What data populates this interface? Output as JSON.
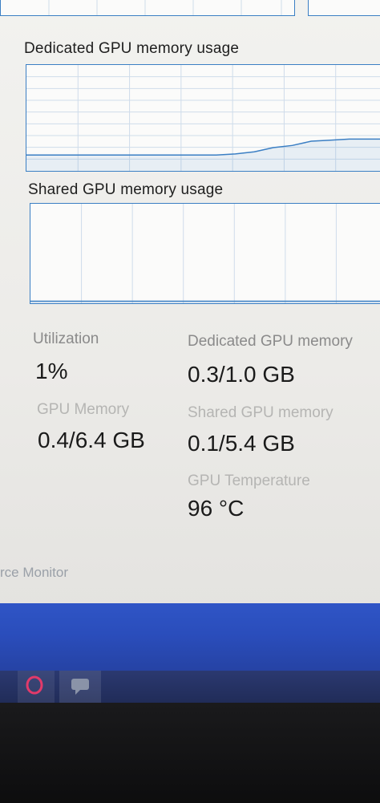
{
  "sections": {
    "dedicated_usage_title": "Dedicated GPU memory usage",
    "shared_usage_title": "Shared GPU memory usage"
  },
  "stats": {
    "utilization": {
      "label": "Utilization",
      "value": "1%"
    },
    "gpu_memory": {
      "label": "GPU Memory",
      "value": "0.4/6.4 GB"
    },
    "dedicated_gpu_memory": {
      "label": "Dedicated GPU memory",
      "value": "0.3/1.0 GB"
    },
    "shared_gpu_memory": {
      "label": "Shared GPU memory",
      "value": "0.1/5.4 GB"
    },
    "gpu_temperature": {
      "label": "GPU Temperature",
      "value": "96 °C"
    }
  },
  "footer": {
    "resource_monitor_link": "rce Monitor"
  },
  "colors": {
    "graph_border": "#3b7fc4",
    "graph_line": "#3b7fc4",
    "grid": "#cfdcea"
  },
  "chart_data": [
    {
      "type": "line",
      "series": [
        {
          "values": [
            0.15,
            0.15,
            0.15,
            0.15,
            0.15,
            0.15,
            0.15,
            0.15,
            0.15,
            0.15,
            0.15,
            0.16,
            0.18,
            0.22,
            0.24,
            0.28,
            0.29,
            0.3,
            0.3,
            0.3
          ]
        }
      ],
      "ylim": [
        0,
        1
      ]
    },
    {
      "type": "line",
      "series": [
        {
          "values": [
            0.02,
            0.02,
            0.02,
            0.02,
            0.02,
            0.02,
            0.02,
            0.02,
            0.02,
            0.02,
            0.02,
            0.02,
            0.02,
            0.02,
            0.02,
            0.02,
            0.02,
            0.02,
            0.02,
            0.02
          ]
        }
      ],
      "ylim": [
        0,
        1
      ]
    }
  ]
}
